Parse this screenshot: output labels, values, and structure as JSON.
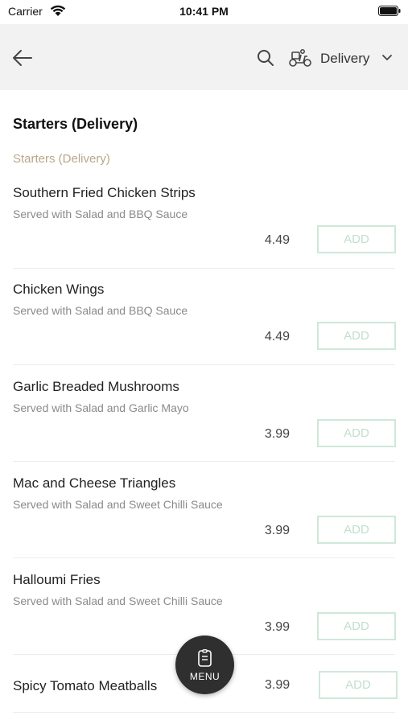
{
  "status_bar": {
    "carrier": "Carrier",
    "time": "10:41 PM"
  },
  "header": {
    "back_icon": "back-arrow-icon",
    "search_icon": "search-icon",
    "delivery_icon": "scooter-icon",
    "delivery_label": "Delivery",
    "chevron_icon": "chevron-down-icon",
    "background": "#f2f2f2"
  },
  "page": {
    "title": "Starters (Delivery)",
    "section_label": "Starters (Delivery)",
    "section_color": "#b8a889"
  },
  "items": [
    {
      "name": "Southern Fried Chicken Strips",
      "description": "Served with Salad and BBQ Sauce",
      "price": "4.49",
      "add_label": "ADD"
    },
    {
      "name": "Chicken Wings",
      "description": "Served with Salad and BBQ Sauce",
      "price": "4.49",
      "add_label": "ADD"
    },
    {
      "name": "Garlic Breaded Mushrooms",
      "description": "Served with Salad and Garlic Mayo",
      "price": "3.99",
      "add_label": "ADD"
    },
    {
      "name": "Mac and Cheese Triangles",
      "description": "Served with Salad and Sweet Chilli Sauce",
      "price": "3.99",
      "add_label": "ADD"
    },
    {
      "name": "Halloumi Fries",
      "description": "Served with Salad and Sweet Chilli Sauce",
      "price": "3.99",
      "add_label": "ADD"
    },
    {
      "name": "Spicy Tomato Meatballs",
      "price": "3.99",
      "add_label": "ADD"
    }
  ],
  "fab": {
    "icon": "menu-list-icon",
    "label": "MENU",
    "color": "#2f2f2f"
  },
  "colors": {
    "add_border": "#cfe8d9",
    "add_text": "#c2dfcd"
  }
}
